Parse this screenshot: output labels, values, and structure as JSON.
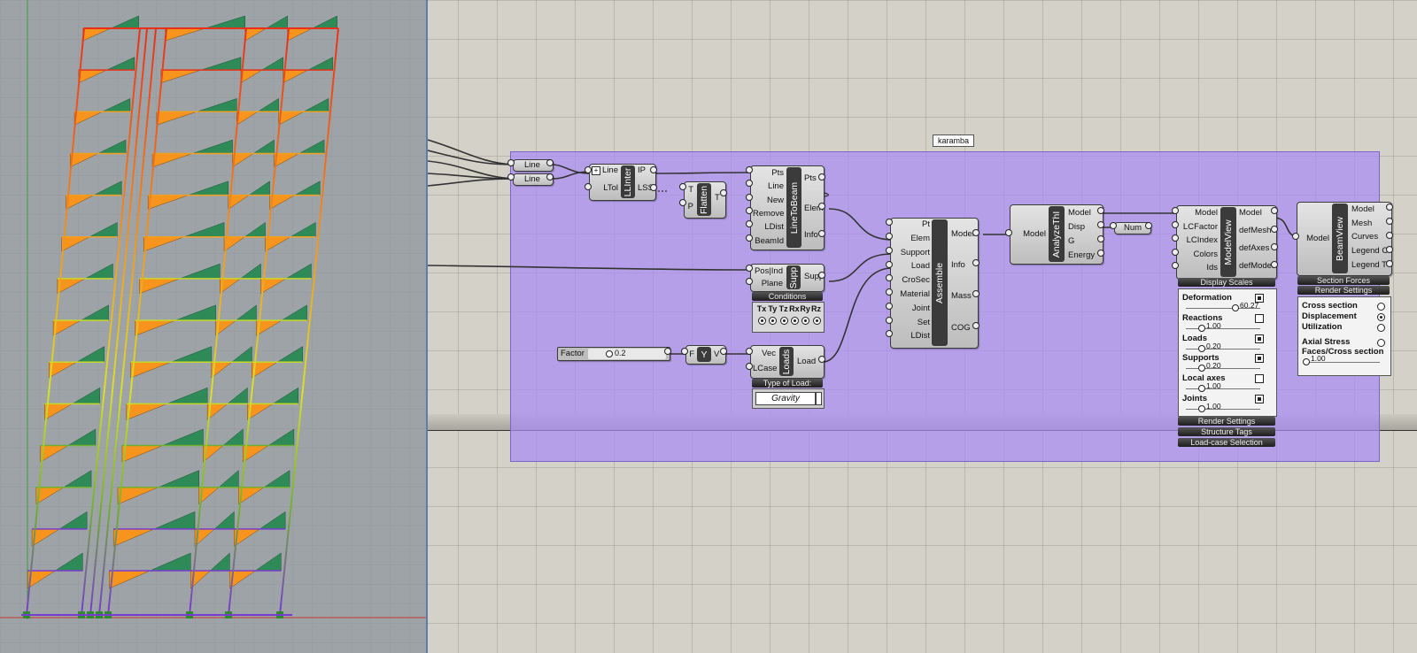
{
  "group": {
    "label": "karamba"
  },
  "line_params": [
    "Line",
    "Line"
  ],
  "llint": {
    "title": "LLInter",
    "inputs": [
      "Line",
      "LTol"
    ],
    "outputs": [
      "IP",
      "LSS"
    ]
  },
  "flatten": {
    "title": "Flatten",
    "inputs": [
      "T",
      "P"
    ],
    "outputs": [
      "T"
    ]
  },
  "line_to_beam": {
    "title": "LineToBeam",
    "inputs": [
      "Pts",
      "Line",
      "New",
      "Remove",
      "LDist",
      "BeamId"
    ],
    "outputs": [
      "Pts",
      "Elem",
      "Info"
    ]
  },
  "support": {
    "title": "Supp",
    "inputs": [
      "Pos|Ind",
      "Plane"
    ],
    "outputs": [
      "Supp"
    ],
    "conditions_label": "Conditions",
    "dof_labels": [
      "Tx",
      "Ty",
      "Tz",
      "Rx",
      "Ry",
      "Rz"
    ]
  },
  "assemble": {
    "title": "Assemble",
    "inputs": [
      "Pt",
      "Elem",
      "Support",
      "Load",
      "CroSec",
      "Material",
      "Joint",
      "Set",
      "LDist"
    ],
    "outputs": [
      "Model",
      "Info",
      "Mass",
      "COG"
    ]
  },
  "analyze": {
    "title": "AnalyzeThI",
    "inputs": [
      "Model"
    ],
    "outputs": [
      "Model",
      "Disp",
      "G",
      "Energy"
    ]
  },
  "num": {
    "label": "Num"
  },
  "model_view": {
    "title": "ModelView",
    "inputs": [
      "Model",
      "LCFactor",
      "LCIndex",
      "Colors",
      "Ids"
    ],
    "outputs": [
      "Model",
      "defMesh",
      "defAxes",
      "defModel"
    ],
    "display_scales": "Display Scales",
    "rows": [
      {
        "label": "Deformation",
        "value": "60.27"
      },
      {
        "label": "Reactions",
        "value": "1.00"
      },
      {
        "label": "Loads",
        "value": "0.20"
      },
      {
        "label": "Supports",
        "value": "0.20"
      },
      {
        "label": "Local axes",
        "value": "1.00"
      },
      {
        "label": "Joints",
        "value": "1.00"
      }
    ],
    "footer": [
      "Render Settings",
      "Structure Tags",
      "Load-case Selection"
    ]
  },
  "beam_view": {
    "title": "BeamView",
    "inputs": [
      "Model"
    ],
    "outputs": [
      "Model",
      "Mesh",
      "Curves",
      "Legend C",
      "Legend T"
    ],
    "section_forces": "Section Forces",
    "render_settings": "Render Settings",
    "options": [
      {
        "label": "Cross section",
        "selected": false
      },
      {
        "label": "Displacement",
        "selected": true
      },
      {
        "label": "Utilization",
        "selected": false
      },
      {
        "label": "Axial Stress",
        "selected": false
      }
    ],
    "faces_label": "Faces/Cross section",
    "faces_value": "1.00"
  },
  "factor": {
    "label": "Factor",
    "value": "0.2"
  },
  "vector_y": {
    "title": "Y",
    "inputs": [
      "F"
    ],
    "outputs": [
      "V"
    ]
  },
  "loads": {
    "title": "Loads",
    "inputs": [
      "Vec",
      "LCase"
    ],
    "outputs": [
      "Load"
    ],
    "type_label": "Type of Load:",
    "type_value": "Gravity"
  },
  "colors": {
    "accent_group": "#aa8cf5",
    "viewport_bg": "#9ea3a8",
    "canvas_bg": "#d4d1c9"
  }
}
